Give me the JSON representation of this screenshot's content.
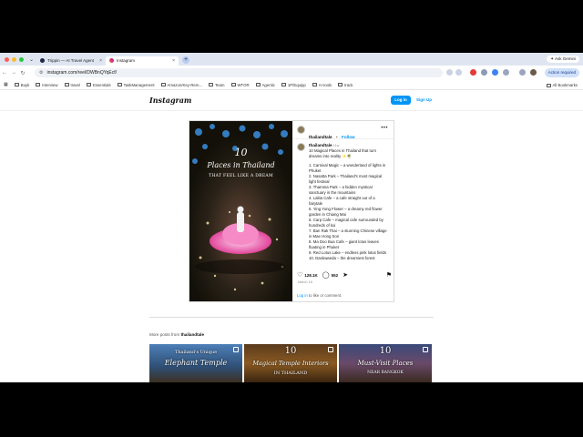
{
  "browser": {
    "tabs": [
      {
        "title": "Trippin — AI Travel Agent",
        "active": false
      },
      {
        "title": "Instagram",
        "active": true
      }
    ],
    "ask_label": "Ask Gemini",
    "url": "instagram.com/reel/DWBnQYqEcf/",
    "action_label": "Action required",
    "bookmarks": [
      "Buyk",
      "Interview",
      "travel",
      "Essentials",
      "TaskManagement",
      "Amazon/Key-Rem...",
      "Team",
      "WTOR",
      "Agentic",
      "1P/Equipp",
      "AI tools",
      "track"
    ],
    "all_bookmarks": "All Bookmarks",
    "colors": {
      "tabstrip": "#dfe6f2",
      "accent": "#0095f6"
    }
  },
  "instagram": {
    "logo": "Instagram",
    "login": "Log in",
    "signup": "Sign Up",
    "post": {
      "media_number": "10",
      "media_title_1": "Places in Thailand",
      "media_title_2": "THAT FEEL LIKE A DREAM",
      "username": "thailandtale",
      "follow_sep": "•",
      "follow": "Follow",
      "caption_user": "thailandtale",
      "caption_time": "11w",
      "caption_intro": "10 Magical Places in Thailand that turn dreams into reality ✨🌴",
      "caption_items": [
        "1. Carnival Magic – a wonderland of lights in Phuket",
        "2. Nasatta Park – Thailand's most magical light festival",
        "3. Thamma Park – a hidden mystical sanctuary in the mountains",
        "4. Lalita Cafe – a cafe straight out of a fairytale",
        "5. Ying Yong Flower – a dreamy red flower garden in Chiang Mai",
        "6. Carp Cafe – magical cafe surrounded by hundreds of koi",
        "7. Ban Rak Thai – a stunning Chinese village in Mae Hong Son",
        "8. Ma Doo Bua Cafe – giant lotus leaves floating in Phuket",
        "9. Red Lotus Lake – endless pink lotus fields",
        "10. Dankwaeda – the dreamiest forest"
      ],
      "likes": "128.1K",
      "comments": "552",
      "date": "March 18",
      "login_prompt_link": "Log in",
      "login_prompt_rest": "to like or comment."
    },
    "more_prefix": "More posts from",
    "more_user": "thailandtale",
    "thumbs": [
      {
        "line1": "Thailand's Unique",
        "line2": "Elephant Temple",
        "line3": ""
      },
      {
        "line1": "10",
        "line2": "Magical Temple Interiors",
        "line3": "IN THAILAND"
      },
      {
        "line1": "10",
        "line2": "Must-Visit Places",
        "line3": "NEAR BANGKOK"
      }
    ]
  }
}
